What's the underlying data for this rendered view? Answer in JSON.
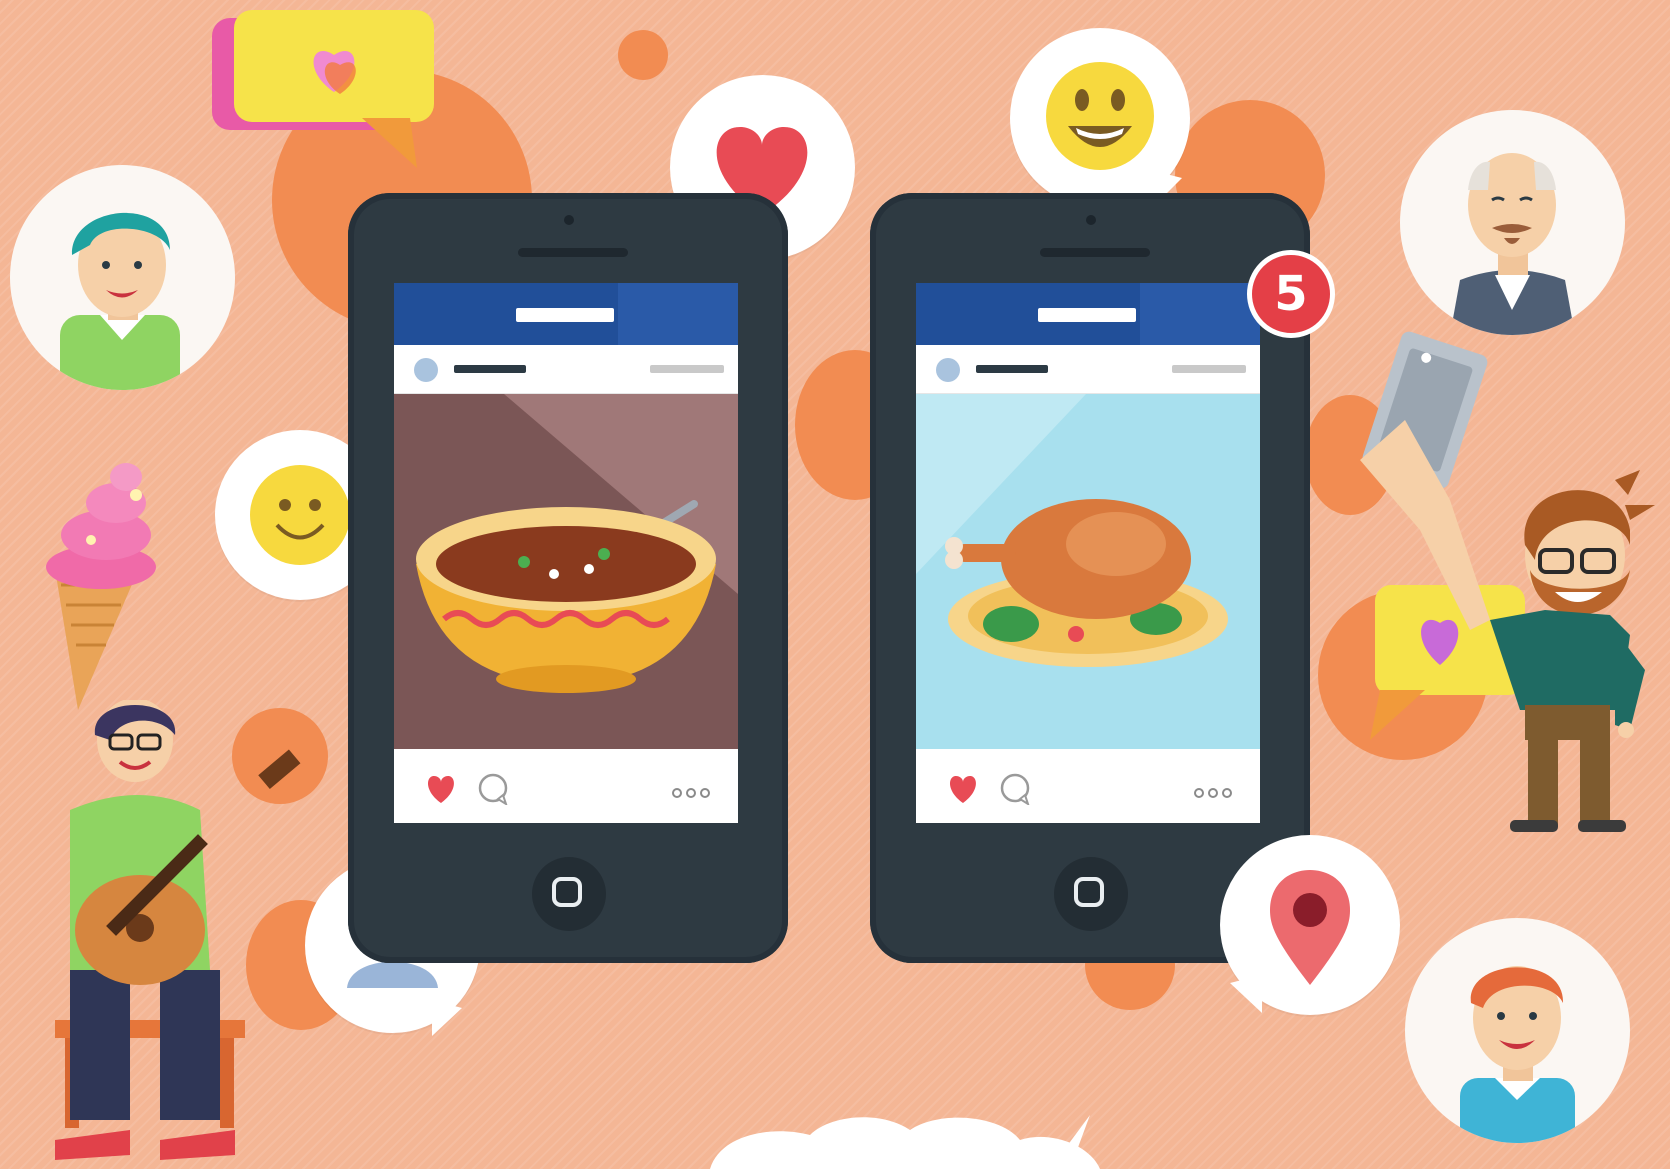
{
  "notification_badge": {
    "count": "5"
  },
  "icons": {
    "left_phone_post": "soup-bowl-icon",
    "right_phone_post": "roast-chicken-icon",
    "like": "heart-icon",
    "comment": "comment-bubble-icon",
    "more": "more-dots-icon",
    "home_button": "home-button-icon",
    "bubbles": [
      "heart-icon",
      "smiley-icon",
      "smiley-icon",
      "user-icon",
      "location-pin-icon"
    ],
    "stickers": [
      "chat-heart-sticker-icon",
      "chat-heart-sticker-icon",
      "ice-cream-icon",
      "selfie-phone-icon"
    ]
  },
  "colors": {
    "background": "#f4b695",
    "accent_circles": "#f28c52",
    "phone_body": "#2e3a42",
    "app_bar": "#214f99",
    "heart": "#e84b55",
    "badge": "#e43f47",
    "smiley": "#f7d93e"
  }
}
